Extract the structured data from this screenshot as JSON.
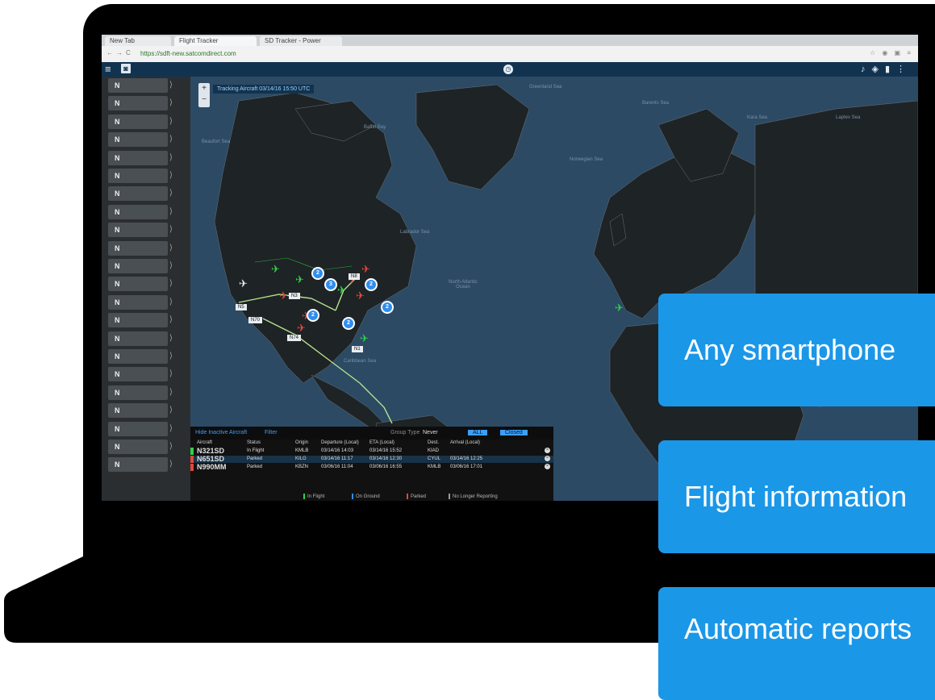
{
  "browser": {
    "tabs": [
      "New Tab",
      "Flight Tracker",
      "SD Tracker - Power"
    ],
    "url": "https://sdft-new.satcomdirect.com"
  },
  "map": {
    "timestamp": "Tracking Aircraft  03/14/16 15:50 UTC",
    "seas": [
      "Greenland Sea",
      "Barents Sea",
      "Kara Sea",
      "Laptev Sea",
      "Beaufort Sea",
      "Baffin Bay",
      "Norwegian Sea",
      "Labrador Sea",
      "North Atlantic Ocean",
      "Caribbean Sea"
    ],
    "aircraft_labels": [
      "N321SD",
      "N651SD",
      "N990MM",
      "N5",
      "N3",
      "N70",
      "N74",
      "N8",
      "N1"
    ],
    "clusters": [
      "2",
      "3",
      "2",
      "2",
      "2",
      "2"
    ]
  },
  "sidebar": {
    "items": [
      "N",
      "N",
      "N",
      "N",
      "N",
      "N",
      "N",
      "N",
      "N",
      "N",
      "N",
      "N",
      "N",
      "N",
      "N",
      "N",
      "N",
      "N",
      "N",
      "N",
      "N",
      "N"
    ]
  },
  "flight_panel": {
    "hide_active": "Hide Inactive Aircraft",
    "filter": "Filter",
    "group_label": "Group Type",
    "group_value": "Never",
    "toggle_a": "ALL",
    "toggle_b": "Closed",
    "columns": [
      "Aircraft",
      "Status",
      "Origin",
      "Departure (Local)",
      "ETA (Local)",
      "Dest.",
      "Arrival (Local)"
    ],
    "rows": [
      {
        "aircraft": "N321SD",
        "status": "In Flight",
        "origin": "KMLB",
        "departure": "03/14/16 14:03",
        "eta": "03/14/16 15:52",
        "dest": "KIAD",
        "arrival": "",
        "color": "#2fd14a"
      },
      {
        "aircraft": "N651SD",
        "status": "Parked",
        "origin": "KILG",
        "departure": "03/14/16 11:17",
        "eta": "03/14/16 12:30",
        "dest": "CYUL",
        "arrival": "03/14/16 12:25",
        "color": "#e2473d"
      },
      {
        "aircraft": "N990MM",
        "status": "Parked",
        "origin": "KBZN",
        "departure": "03/06/16 11:04",
        "eta": "03/06/16 16:55",
        "dest": "KMLB",
        "arrival": "03/06/16 17:01",
        "color": "#e2473d"
      }
    ],
    "legend": [
      {
        "label": "In Flight",
        "color": "#2fd14a"
      },
      {
        "label": "On Ground",
        "color": "#2f8ef0"
      },
      {
        "label": "Parked",
        "color": "#e2473d"
      },
      {
        "label": "No Longer Reporting",
        "color": "#9b9b9b"
      }
    ]
  },
  "callouts": [
    "Any smartphone",
    "Flight information",
    "Automatic reports"
  ]
}
